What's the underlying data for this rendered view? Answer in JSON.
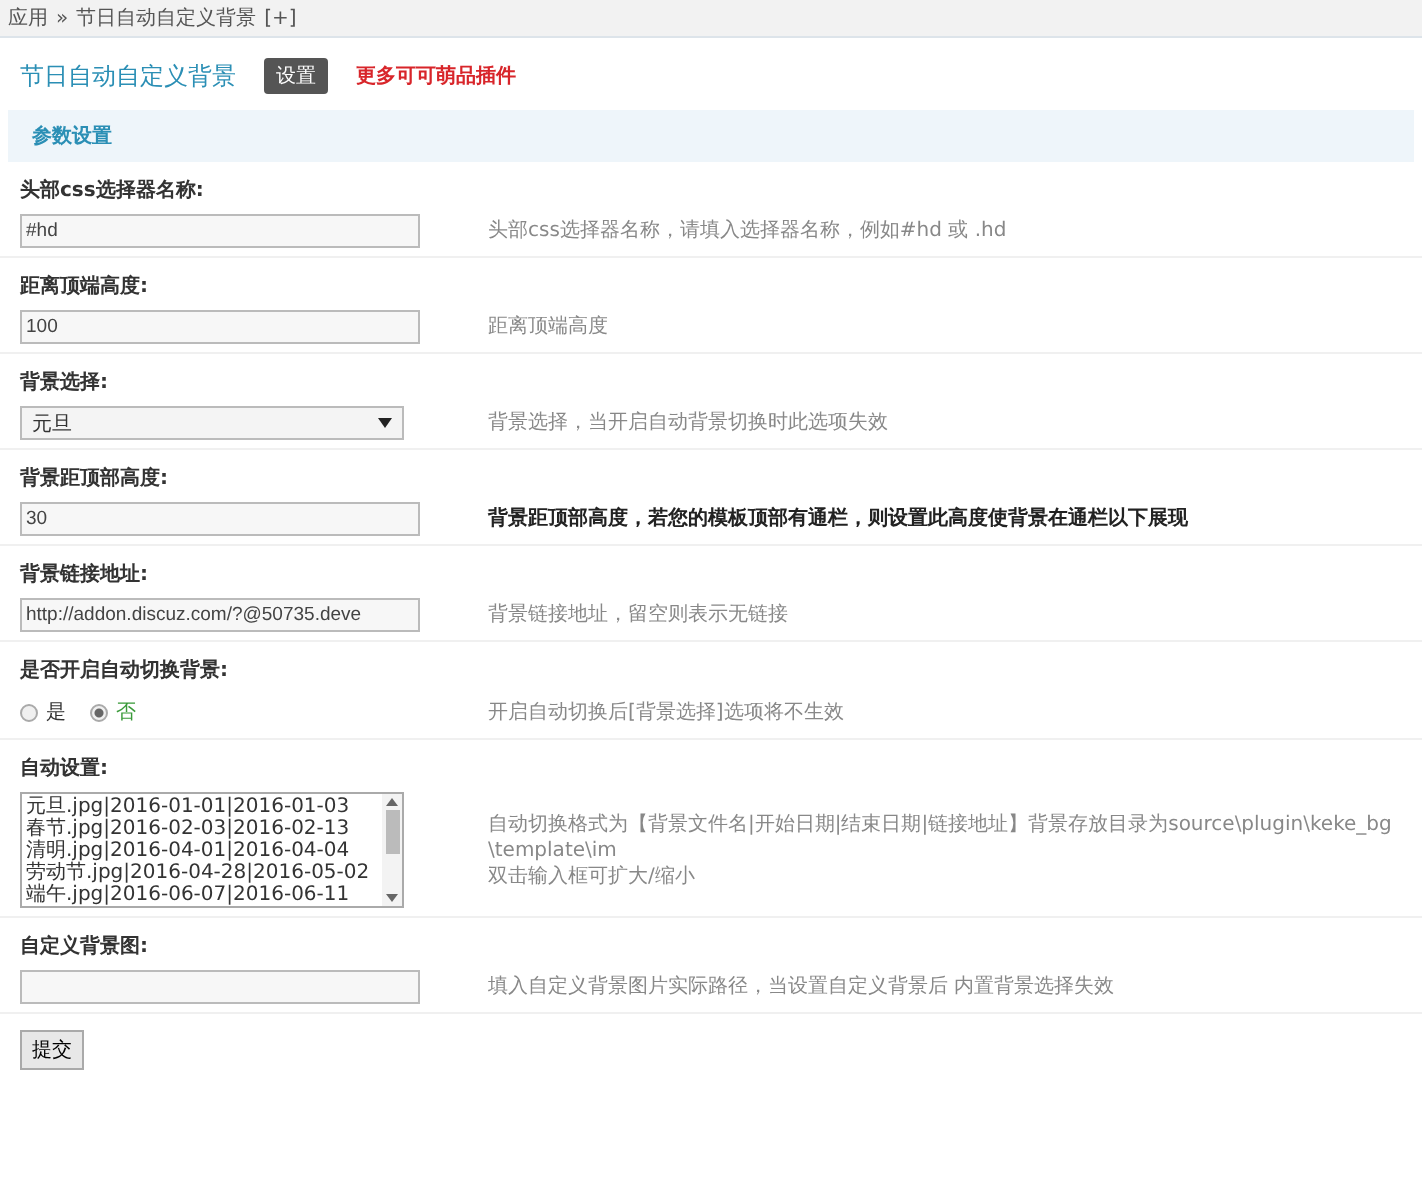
{
  "breadcrumb": {
    "items": [
      "应用",
      "节日自动自定义背景"
    ],
    "separator": "»",
    "expand": "[+]"
  },
  "header": {
    "title": "节日自动自定义背景",
    "button": "设置",
    "link": "更多可可萌品插件"
  },
  "section": {
    "title": "参数设置"
  },
  "fields": [
    {
      "kind": "text",
      "label": "头部css选择器名称:",
      "value": "#hd",
      "hint": [
        "头部css选择器名称，请填入选择器名称，例如#hd 或 .hd"
      ],
      "hint_bold": false
    },
    {
      "kind": "text",
      "label": "距离顶端高度:",
      "value": "100",
      "hint": [
        "距离顶端高度"
      ],
      "hint_bold": false
    },
    {
      "kind": "select",
      "label": "背景选择:",
      "value": "元旦",
      "hint": [
        "背景选择，当开启自动背景切换时此选项失效"
      ],
      "hint_bold": false
    },
    {
      "kind": "text",
      "label": "背景距顶部高度:",
      "value": "30",
      "hint": [
        "背景距顶部高度，若您的模板顶部有通栏，则设置此高度使背景在通栏以下展现"
      ],
      "hint_bold": true
    },
    {
      "kind": "text",
      "label": "背景链接地址:",
      "value": "http://addon.discuz.com/?@50735.deve",
      "hint": [
        "背景链接地址，留空则表示无链接"
      ],
      "hint_bold": false
    },
    {
      "kind": "radio",
      "label": "是否开启自动切换背景:",
      "options": [
        {
          "label": "是",
          "selected": false
        },
        {
          "label": "否",
          "selected": true
        }
      ],
      "hint": [
        "开启自动切换后[背景选择]选项将不生效"
      ],
      "hint_bold": false
    },
    {
      "kind": "textarea",
      "label": "自动设置:",
      "lines": [
        "元旦.jpg|2016-01-01|2016-01-03",
        "春节.jpg|2016-02-03|2016-02-13",
        "清明.jpg|2016-04-01|2016-04-04",
        "劳动节.jpg|2016-04-28|2016-05-02",
        "端午.jpg|2016-06-07|2016-06-11"
      ],
      "hint": [
        "自动切换格式为【背景文件名|开始日期|结束日期|链接地址】背景存放目录为source\\plugin\\keke_bg\\template\\im",
        "双击输入框可扩大/缩小"
      ],
      "hint_bold": false
    },
    {
      "kind": "text",
      "label": "自定义背景图:",
      "hint": [
        "填入自定义背景图片实际路径，当设置自定义背景后 内置背景选择失效"
      ],
      "hint_bold": false
    }
  ],
  "submit": "提交"
}
